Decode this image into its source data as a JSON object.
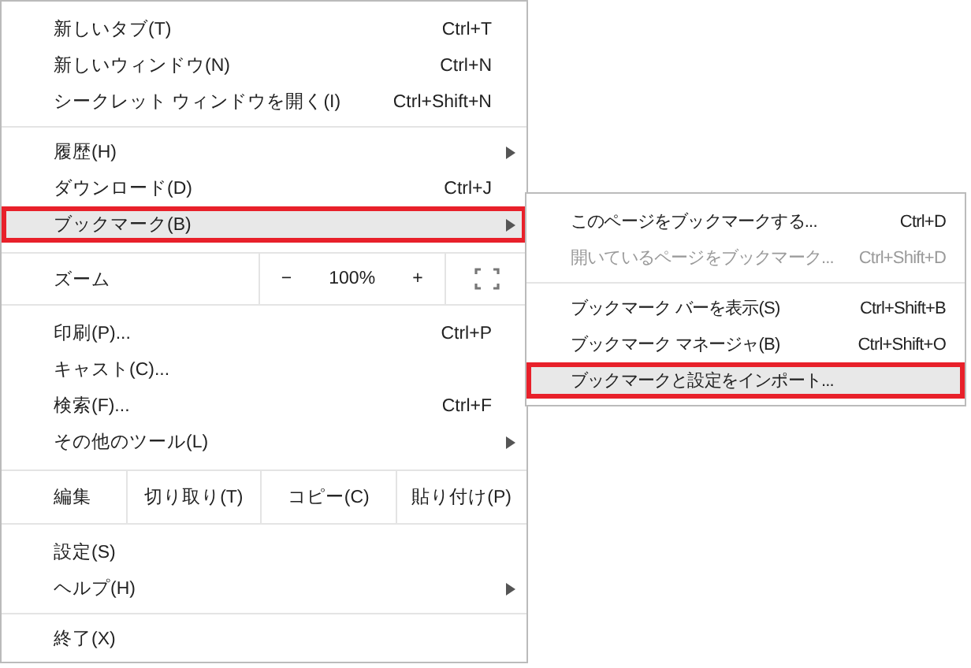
{
  "menu": {
    "items": [
      {
        "kind": "item",
        "label": "新しいタブ(T)",
        "shortcut": "Ctrl+T",
        "submenu": false,
        "selected": false
      },
      {
        "kind": "item",
        "label": "新しいウィンドウ(N)",
        "shortcut": "Ctrl+N",
        "submenu": false,
        "selected": false
      },
      {
        "kind": "item",
        "label": "シークレット ウィンドウを開く(I)",
        "shortcut": "Ctrl+Shift+N",
        "submenu": false,
        "selected": false
      },
      {
        "kind": "separator"
      },
      {
        "kind": "item",
        "label": "履歴(H)",
        "submenu": true,
        "selected": false
      },
      {
        "kind": "item",
        "label": "ダウンロード(D)",
        "shortcut": "Ctrl+J",
        "submenu": false,
        "selected": false
      },
      {
        "kind": "item",
        "label": "ブックマーク(B)",
        "submenu": true,
        "selected": true
      },
      {
        "kind": "zoom",
        "label": "ズーム",
        "minus": "−",
        "value": "100%",
        "plus": "+"
      },
      {
        "kind": "item",
        "label": "印刷(P)...",
        "shortcut": "Ctrl+P",
        "submenu": false,
        "selected": false
      },
      {
        "kind": "item",
        "label": "キャスト(C)...",
        "submenu": false,
        "selected": false
      },
      {
        "kind": "item",
        "label": "検索(F)...",
        "shortcut": "Ctrl+F",
        "submenu": false,
        "selected": false
      },
      {
        "kind": "item",
        "label": "その他のツール(L)",
        "submenu": true,
        "selected": false
      },
      {
        "kind": "edit",
        "label": "編集",
        "buttons": [
          "切り取り(T)",
          "コピー(C)",
          "貼り付け(P)"
        ]
      },
      {
        "kind": "item",
        "label": "設定(S)",
        "submenu": false,
        "selected": false
      },
      {
        "kind": "item",
        "label": "ヘルプ(H)",
        "submenu": true,
        "selected": false
      },
      {
        "kind": "separator"
      },
      {
        "kind": "item",
        "label": "終了(X)",
        "submenu": false,
        "selected": false
      }
    ]
  },
  "submenu": {
    "items": [
      {
        "kind": "item",
        "label": "このページをブックマークする...",
        "shortcut": "Ctrl+D",
        "disabled": false,
        "selected": false
      },
      {
        "kind": "item",
        "label": "開いているページをブックマーク...",
        "shortcut": "Ctrl+Shift+D",
        "disabled": true,
        "selected": false
      },
      {
        "kind": "separator"
      },
      {
        "kind": "item",
        "label": "ブックマーク バーを表示(S)",
        "shortcut": "Ctrl+Shift+B",
        "disabled": false,
        "selected": false
      },
      {
        "kind": "item",
        "label": "ブックマーク マネージャ(B)",
        "shortcut": "Ctrl+Shift+O",
        "disabled": false,
        "selected": false
      },
      {
        "kind": "item",
        "label": "ブックマークと設定をインポート...",
        "disabled": false,
        "selected": true
      }
    ]
  }
}
